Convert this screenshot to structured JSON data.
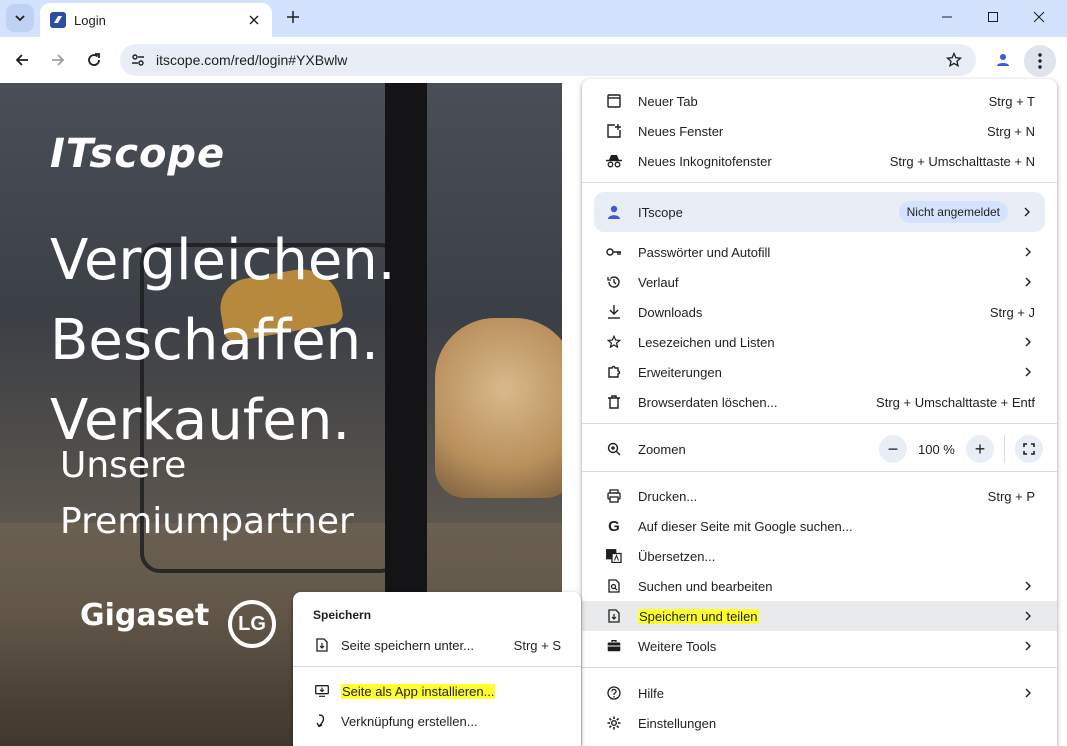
{
  "browser": {
    "tab_title": "Login",
    "url": "itscope.com/red/login#YXBwlw",
    "accent": "#d3e3fd"
  },
  "hero": {
    "logo": "ITscope",
    "headline": [
      "Vergleichen.",
      "Beschaffen.",
      "Verkaufen."
    ],
    "premium": [
      "Unsere",
      "Premiumpartner"
    ],
    "partner1": "Gigaset",
    "partner2": "LG"
  },
  "menu": {
    "new_tab": {
      "label": "Neuer Tab",
      "shortcut": "Strg + T"
    },
    "new_window": {
      "label": "Neues Fenster",
      "shortcut": "Strg + N"
    },
    "incognito": {
      "label": "Neues Inkognitofenster",
      "shortcut": "Strg + Umschalttaste + N"
    },
    "profile": {
      "label": "ITscope",
      "badge": "Nicht angemeldet"
    },
    "passwords": {
      "label": "Passwörter und Autofill"
    },
    "history": {
      "label": "Verlauf"
    },
    "downloads": {
      "label": "Downloads",
      "shortcut": "Strg + J"
    },
    "bookmarks": {
      "label": "Lesezeichen und Listen"
    },
    "extensions": {
      "label": "Erweiterungen"
    },
    "clear_data": {
      "label": "Browserdaten löschen...",
      "shortcut": "Strg + Umschalttaste + Entf"
    },
    "zoom": {
      "label": "Zoomen",
      "value": "100 %",
      "minus": "−",
      "plus": "+"
    },
    "print": {
      "label": "Drucken...",
      "shortcut": "Strg + P"
    },
    "google_search": {
      "label": "Auf dieser Seite mit Google suchen..."
    },
    "translate": {
      "label": "Übersetzen..."
    },
    "find_edit": {
      "label": "Suchen und bearbeiten"
    },
    "save_share": {
      "label": "Speichern und teilen"
    },
    "more_tools": {
      "label": "Weitere Tools"
    },
    "help": {
      "label": "Hilfe"
    },
    "settings": {
      "label": "Einstellungen"
    }
  },
  "submenu": {
    "heading": "Speichern",
    "save_as": {
      "label": "Seite speichern unter...",
      "shortcut": "Strg + S"
    },
    "install_app": {
      "label": "Seite als App installieren..."
    },
    "shortcut": {
      "label": "Verknüpfung erstellen..."
    }
  },
  "highlight_color": "#ffff2b"
}
